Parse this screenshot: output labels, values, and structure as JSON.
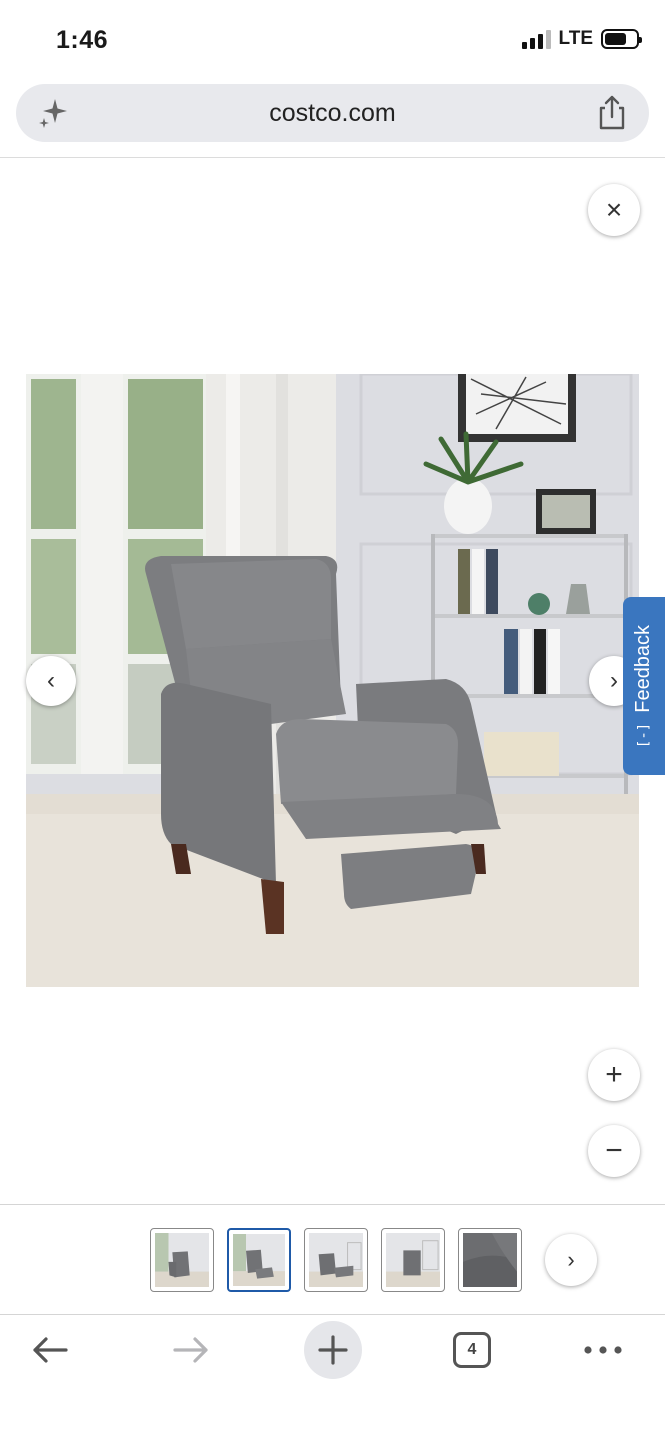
{
  "status_bar": {
    "time": "1:46",
    "network": "LTE",
    "icons": [
      "signal-icon",
      "battery-icon"
    ]
  },
  "browser": {
    "url": "costco.com",
    "sparkle_icon": "sparkle-icon",
    "share_icon": "share-icon"
  },
  "viewer": {
    "close_label": "×",
    "prev_label": "‹",
    "next_label": "›",
    "zoom_in_label": "+",
    "zoom_out_label": "−",
    "image_subject": "gray-fabric-recliner-chair",
    "thumbnails": [
      {
        "subject": "recliner-front",
        "active": false
      },
      {
        "subject": "recliner-reclined",
        "active": true
      },
      {
        "subject": "recliner-side",
        "active": false
      },
      {
        "subject": "recliner-room",
        "active": false
      },
      {
        "subject": "fabric-closeup",
        "active": false
      }
    ],
    "thumb_next_label": "›"
  },
  "feedback": {
    "label": "Feedback",
    "icon_label": "[-]"
  },
  "toolbar": {
    "back_icon": "back-arrow-icon",
    "forward_icon": "forward-arrow-icon",
    "new_tab_icon": "plus-icon",
    "tab_count": "4",
    "more_icon": "more-dots-icon"
  },
  "colors": {
    "accent": "#3a76bf",
    "active_thumb_border": "#1f5aa8",
    "url_bar_bg": "#e8e9ed"
  }
}
